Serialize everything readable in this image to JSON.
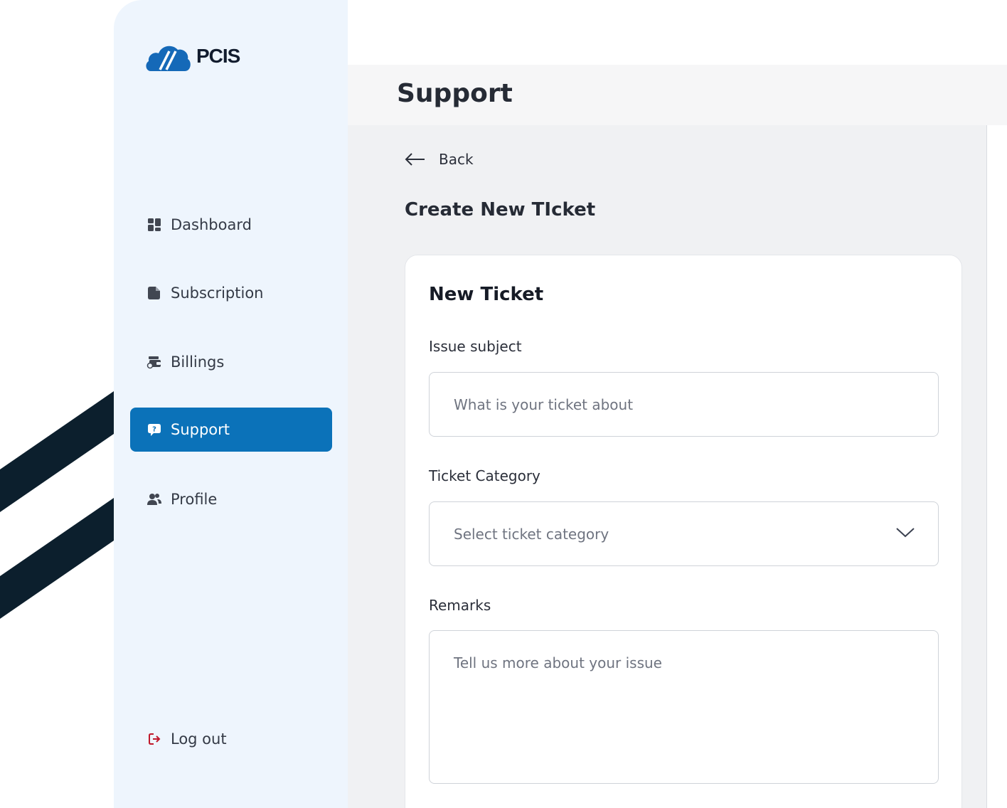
{
  "brand": {
    "name": "PCIS",
    "accent": "#0b72b9",
    "logout_color": "#c0182b"
  },
  "sidebar": {
    "items": [
      {
        "label": "Dashboard",
        "icon": "grid-icon"
      },
      {
        "label": "Subscription",
        "icon": "document-icon"
      },
      {
        "label": "Billings",
        "icon": "wallet-icon"
      },
      {
        "label": "Support",
        "icon": "help-chat-icon",
        "active": true
      },
      {
        "label": "Profile",
        "icon": "users-icon"
      }
    ],
    "logout": {
      "label": "Log out",
      "icon": "logout-icon"
    }
  },
  "header": {
    "title": "Support"
  },
  "main": {
    "back_label": "Back",
    "section_title": "Create New TIcket",
    "form": {
      "title": "New Ticket",
      "subject": {
        "label": "Issue subject",
        "placeholder": "What is your ticket about"
      },
      "category": {
        "label": "Ticket Category",
        "placeholder": "Select ticket category"
      },
      "remarks": {
        "label": "Remarks",
        "placeholder": "Tell us more about your issue"
      }
    }
  }
}
